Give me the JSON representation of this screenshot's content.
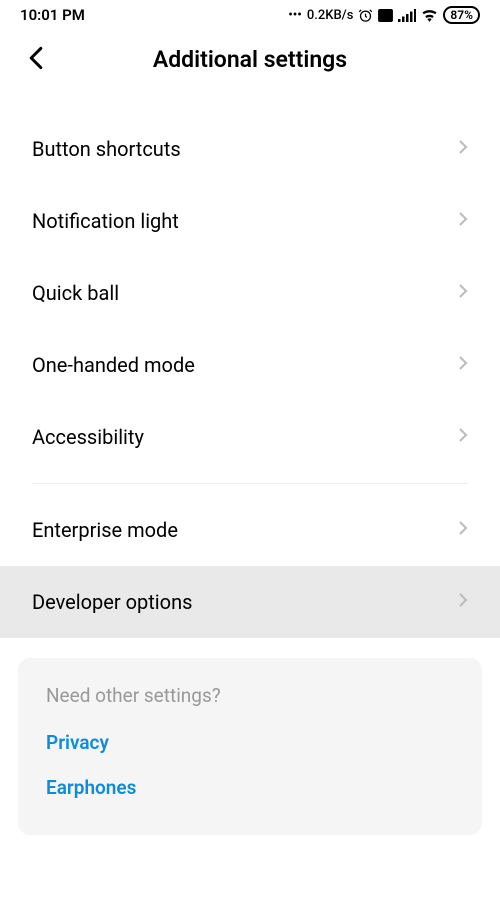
{
  "status_bar": {
    "time": "10:01 PM",
    "speed": "0.2KB/s",
    "battery": "87%"
  },
  "header": {
    "title": "Additional settings"
  },
  "list": {
    "items": [
      {
        "label": "Button shortcuts",
        "highlighted": false
      },
      {
        "label": "Notification light",
        "highlighted": false
      },
      {
        "label": "Quick ball",
        "highlighted": false
      },
      {
        "label": "One-handed mode",
        "highlighted": false
      },
      {
        "label": "Accessibility",
        "highlighted": false
      }
    ],
    "items2": [
      {
        "label": "Enterprise mode",
        "highlighted": false
      },
      {
        "label": "Developer options",
        "highlighted": true
      }
    ]
  },
  "help": {
    "title": "Need other settings?",
    "links": [
      {
        "label": "Privacy"
      },
      {
        "label": "Earphones"
      }
    ]
  }
}
